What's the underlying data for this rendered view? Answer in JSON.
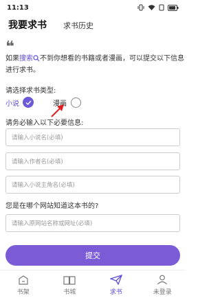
{
  "status": {
    "time": "11:13"
  },
  "tabs": {
    "active": "我要求书",
    "inactive": "求书历史"
  },
  "intro": {
    "quote": "❝",
    "before": "如果",
    "link": "搜索",
    "after": "不到你想看的书籍或者漫画，可以提交以下信息进行求书。"
  },
  "type_section": {
    "label": "请选择求书类型:",
    "options": [
      {
        "label": "小说",
        "selected": true
      },
      {
        "label": "漫画",
        "selected": false
      }
    ]
  },
  "info_section": {
    "label": "请务必输入以下必要信息:",
    "fields": [
      {
        "placeholder": "请输入小说名(必填)"
      },
      {
        "placeholder": "请输入作者名(必填)"
      },
      {
        "placeholder": "请输入小说主角名(必填)"
      }
    ]
  },
  "site_section": {
    "label": "您是在哪个网站知道这本书的?",
    "placeholder": "请输入原网站名称或网址(必填)"
  },
  "submit_label": "提交",
  "bottom_nav": [
    {
      "label": "书架",
      "icon": "bookshelf-icon",
      "active": false
    },
    {
      "label": "书城",
      "icon": "book-icon",
      "active": false
    },
    {
      "label": "求书",
      "icon": "paper-plane-icon",
      "active": true
    },
    {
      "label": "未登录",
      "icon": "user-icon",
      "active": false
    }
  ],
  "colors": {
    "accent": "#7b5cd6",
    "link": "#5b4bd6",
    "arrow": "#e02020"
  }
}
